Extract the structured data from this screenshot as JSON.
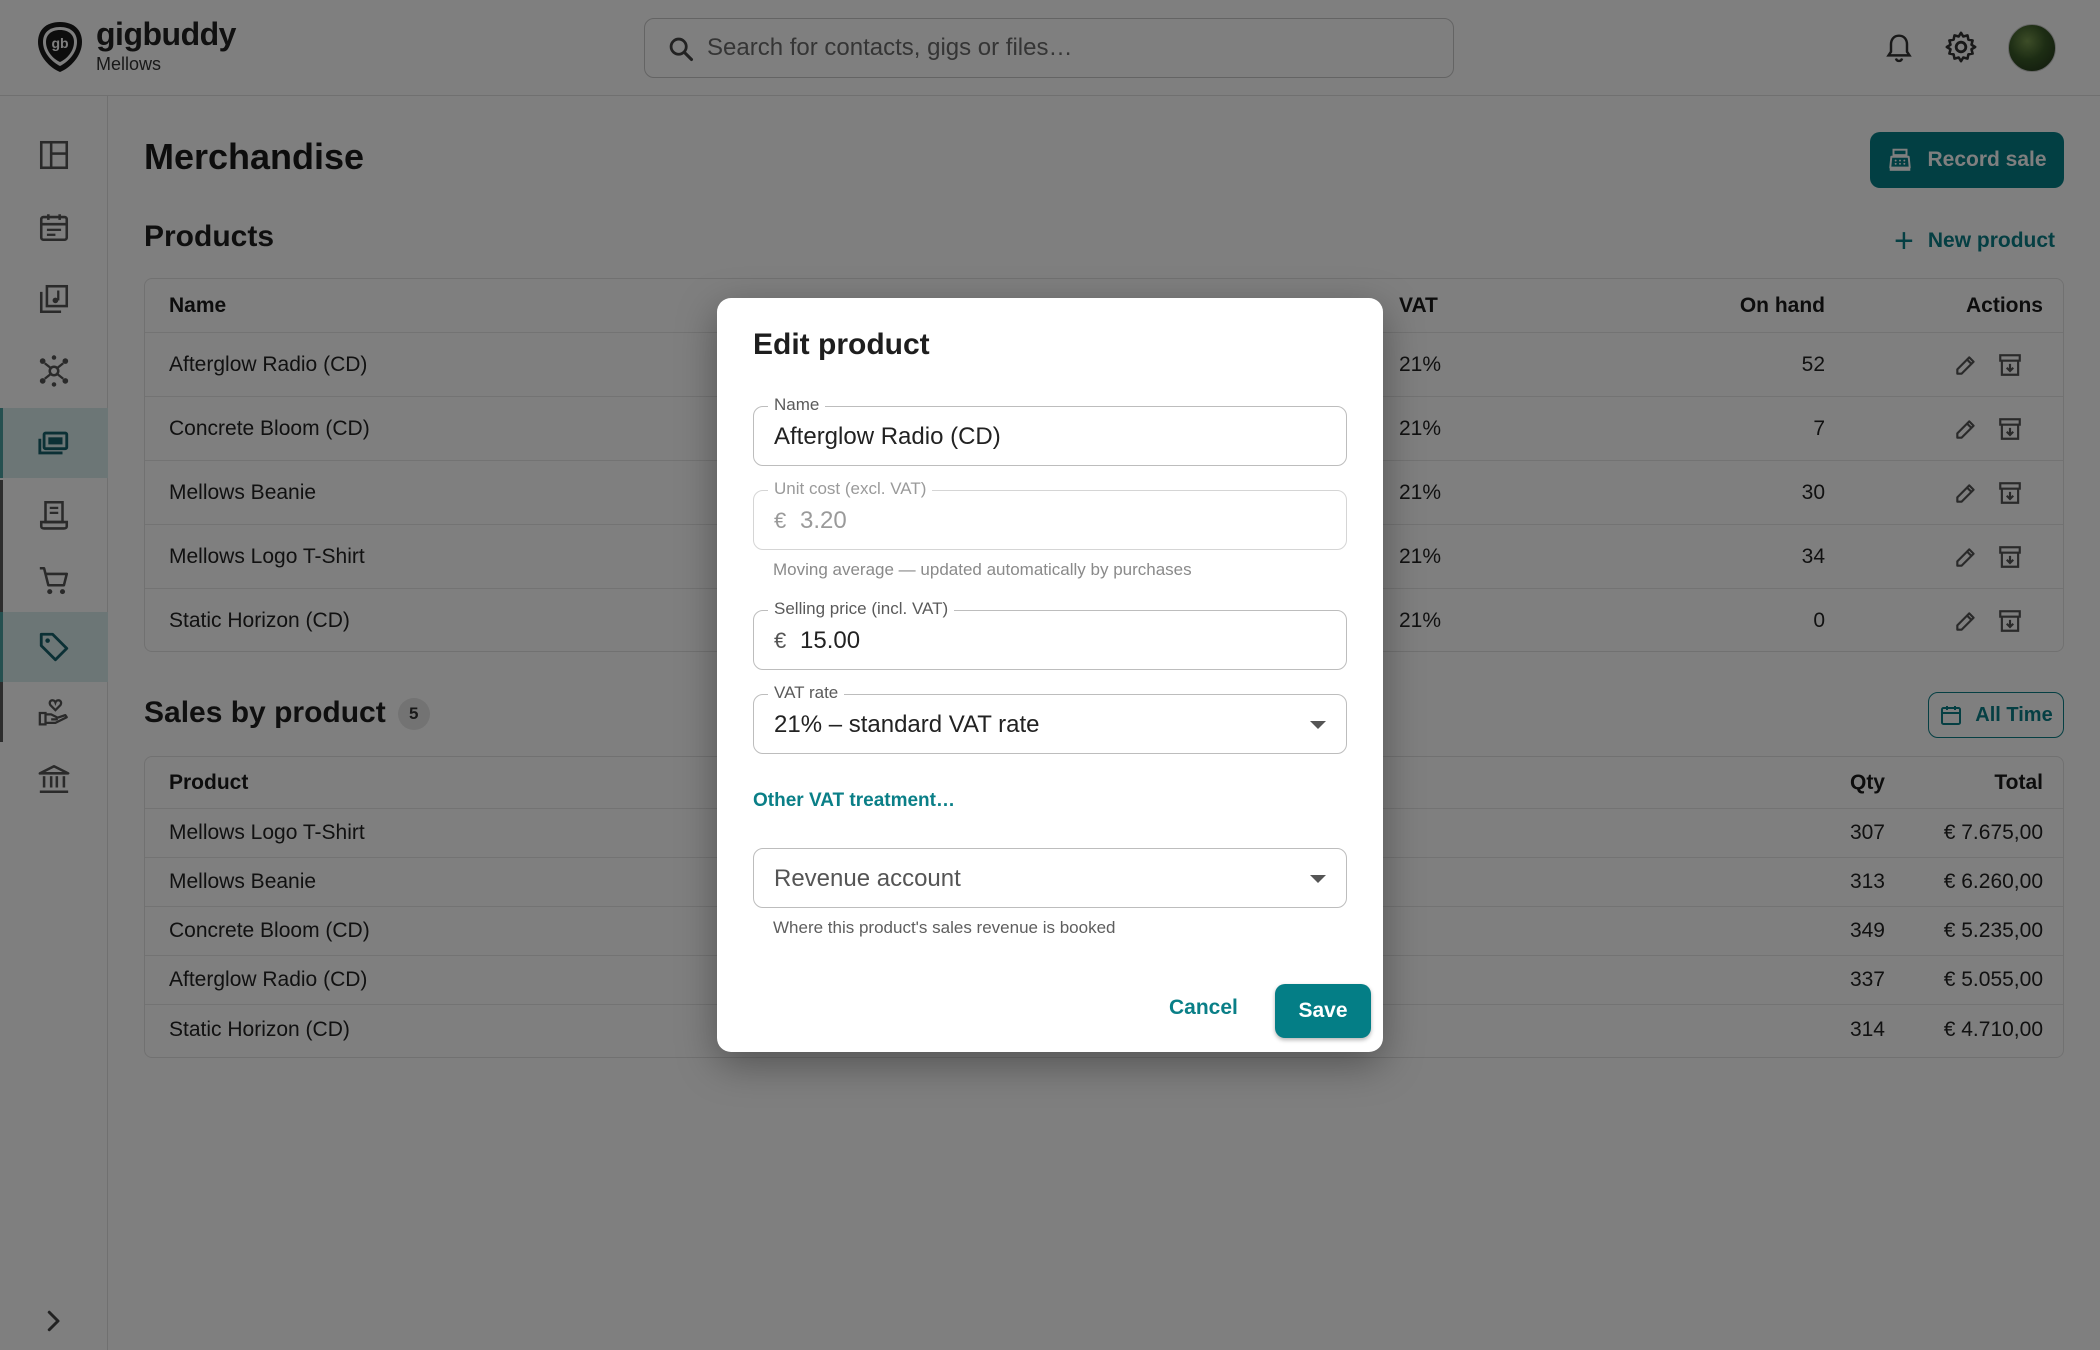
{
  "app": {
    "brand": "gigbuddy",
    "workspace": "Mellows"
  },
  "search": {
    "placeholder": "Search for contacts, gigs or files…"
  },
  "page": {
    "title": "Merchandise",
    "record_sale": "Record sale"
  },
  "products": {
    "title": "Products",
    "new_label": "New product",
    "headers": {
      "name": "Name",
      "vat": "VAT",
      "on_hand": "On hand",
      "actions": "Actions"
    },
    "rows": [
      {
        "name": "Afterglow Radio (CD)",
        "vat": "21%",
        "on_hand": "52"
      },
      {
        "name": "Concrete Bloom (CD)",
        "vat": "21%",
        "on_hand": "7"
      },
      {
        "name": "Mellows Beanie",
        "vat": "21%",
        "on_hand": "30"
      },
      {
        "name": "Mellows Logo T-Shirt",
        "vat": "21%",
        "on_hand": "34"
      },
      {
        "name": "Static Horizon (CD)",
        "vat": "21%",
        "on_hand": "0"
      }
    ]
  },
  "sales": {
    "title": "Sales by product",
    "count": "5",
    "range": "All Time",
    "headers": {
      "product": "Product",
      "qty": "Qty",
      "total": "Total"
    },
    "rows": [
      {
        "product": "Mellows Logo T-Shirt",
        "qty": "307",
        "total": "€ 7.675,00"
      },
      {
        "product": "Mellows Beanie",
        "qty": "313",
        "total": "€ 6.260,00"
      },
      {
        "product": "Concrete Bloom (CD)",
        "qty": "349",
        "total": "€ 5.235,00"
      },
      {
        "product": "Afterglow Radio (CD)",
        "qty": "337",
        "total": "€ 5.055,00"
      },
      {
        "product": "Static Horizon (CD)",
        "qty": "314",
        "total": "€ 4.710,00"
      }
    ]
  },
  "dialog": {
    "title": "Edit product",
    "name": {
      "label": "Name",
      "value": "Afterglow Radio (CD)"
    },
    "unit_cost": {
      "label": "Unit cost (excl. VAT)",
      "currency": "€",
      "value": "3.20",
      "helper": "Moving average — updated automatically by purchases"
    },
    "selling_price": {
      "label": "Selling price (incl. VAT)",
      "currency": "€",
      "value": "15.00"
    },
    "vat_rate": {
      "label": "VAT rate",
      "value": "21% – standard VAT rate"
    },
    "other_vat": "Other VAT treatment…",
    "revenue": {
      "placeholder": "Revenue account",
      "helper": "Where this product's sales revenue is booked"
    },
    "cancel": "Cancel",
    "save": "Save"
  },
  "colors": {
    "accent": "#047e86",
    "accent_text": "#0a7f87",
    "active_nav": "#d9ecec"
  },
  "icons": [
    "gb-logo-icon",
    "search-icon",
    "bell-icon",
    "gear-icon",
    "dashboard-icon",
    "calendar-icon",
    "music-library-icon",
    "network-icon",
    "merch-icon",
    "receipt-icon",
    "cart-icon",
    "tag-icon",
    "hand-heart-icon",
    "bank-icon",
    "chevron-right-icon",
    "cash-register-icon",
    "plus-icon",
    "pencil-icon",
    "archive-icon",
    "calendar-small-icon",
    "chevron-down-icon"
  ]
}
